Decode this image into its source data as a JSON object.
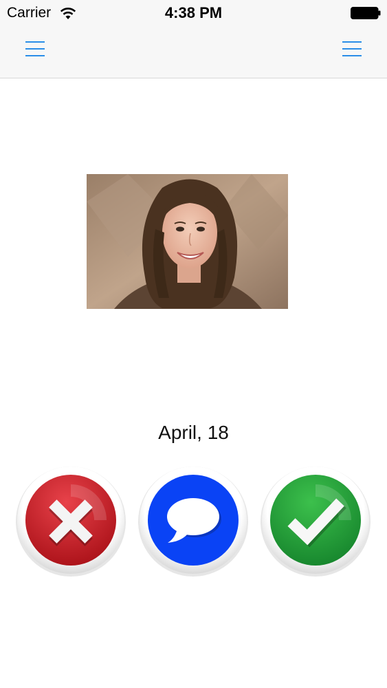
{
  "status_bar": {
    "carrier": "Carrier",
    "time": "4:38 PM",
    "icons": [
      "wifi-icon",
      "battery-icon"
    ]
  },
  "nav_bar": {
    "left_button": "menu-icon",
    "right_button": "menu-icon",
    "accent_color": "#2a8ee8"
  },
  "profile": {
    "photo": "profile-photo",
    "date": "April, 18"
  },
  "actions": [
    {
      "name": "reject",
      "icon": "x-icon",
      "color": "#c8161d"
    },
    {
      "name": "message",
      "icon": "speech-bubble-icon",
      "color": "#0a43f5"
    },
    {
      "name": "accept",
      "icon": "checkmark-icon",
      "color": "#1f9b2f"
    }
  ]
}
